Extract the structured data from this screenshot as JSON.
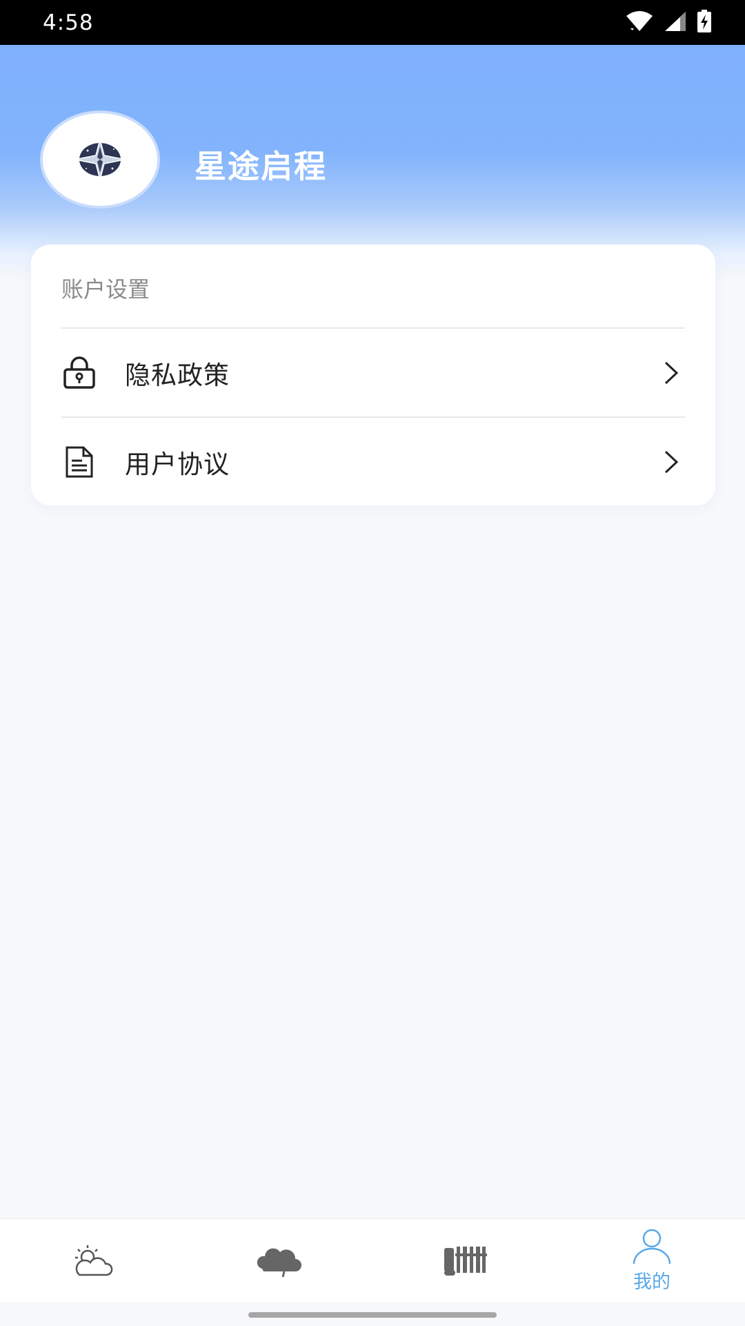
{
  "status_bar": {
    "time": "4:58",
    "icons": [
      "wifi-icon",
      "signal-icon",
      "battery-charging-icon"
    ]
  },
  "profile": {
    "app_name": "星途启程",
    "avatar_icon": "compass-star-logo"
  },
  "account_settings": {
    "title": "账户设置",
    "items": [
      {
        "label": "隐私政策",
        "icon": "lock-icon"
      },
      {
        "label": "用户协议",
        "icon": "document-icon"
      }
    ]
  },
  "bottom_nav": {
    "items": [
      {
        "icon": "sun-cloud-icon",
        "label": ""
      },
      {
        "icon": "cloud-icon",
        "label": ""
      },
      {
        "icon": "barcode-icon",
        "label": ""
      },
      {
        "icon": "person-icon",
        "label": "我的",
        "active": true
      }
    ]
  },
  "colors": {
    "header_blue": "#7fb0fc",
    "accent": "#5aa8e8",
    "background": "#f6f8fb"
  }
}
